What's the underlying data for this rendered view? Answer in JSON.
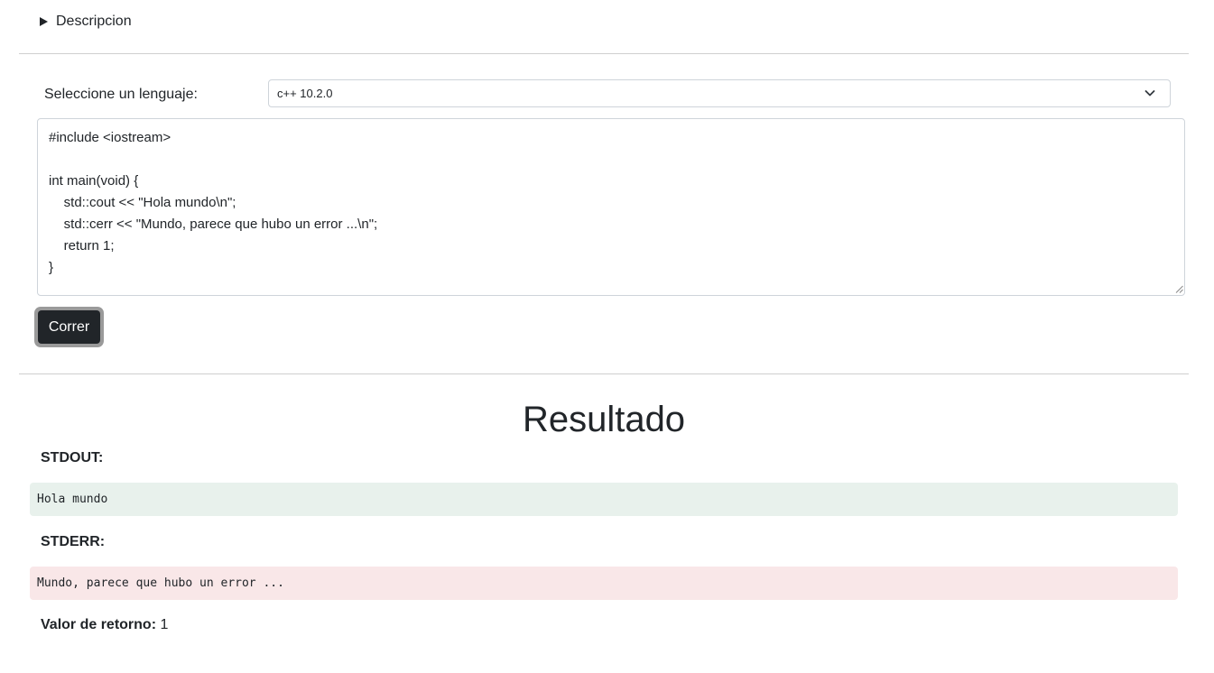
{
  "details": {
    "summary": "Descripcion"
  },
  "form": {
    "language_label": "Seleccione un lenguaje:",
    "language_selected": "c++ 10.2.0",
    "code": "#include <iostream>\n\nint main(void) {\n\tstd::cout << \"Hola mundo\\n\";\n\tstd::cerr << \"Mundo, parece que hubo un error ...\\n\";\n\treturn 1;\n}",
    "run_button": "Correr"
  },
  "result": {
    "title": "Resultado",
    "stdout_label": "STDOUT:",
    "stdout": "Hola mundo",
    "stderr_label": "STDERR:",
    "stderr": "Mundo, parece que hubo un error ...",
    "return_label": "Valor de retorno:",
    "return_value": "1"
  },
  "colors": {
    "button_bg": "#212529",
    "stdout_bg": "#e8f1ec",
    "stderr_bg": "#f9e7e8"
  },
  "icons": {
    "details_toggle": "triangle-right-icon",
    "select_arrow": "chevron-down-icon",
    "textarea_resize": "resize-handle-icon"
  }
}
